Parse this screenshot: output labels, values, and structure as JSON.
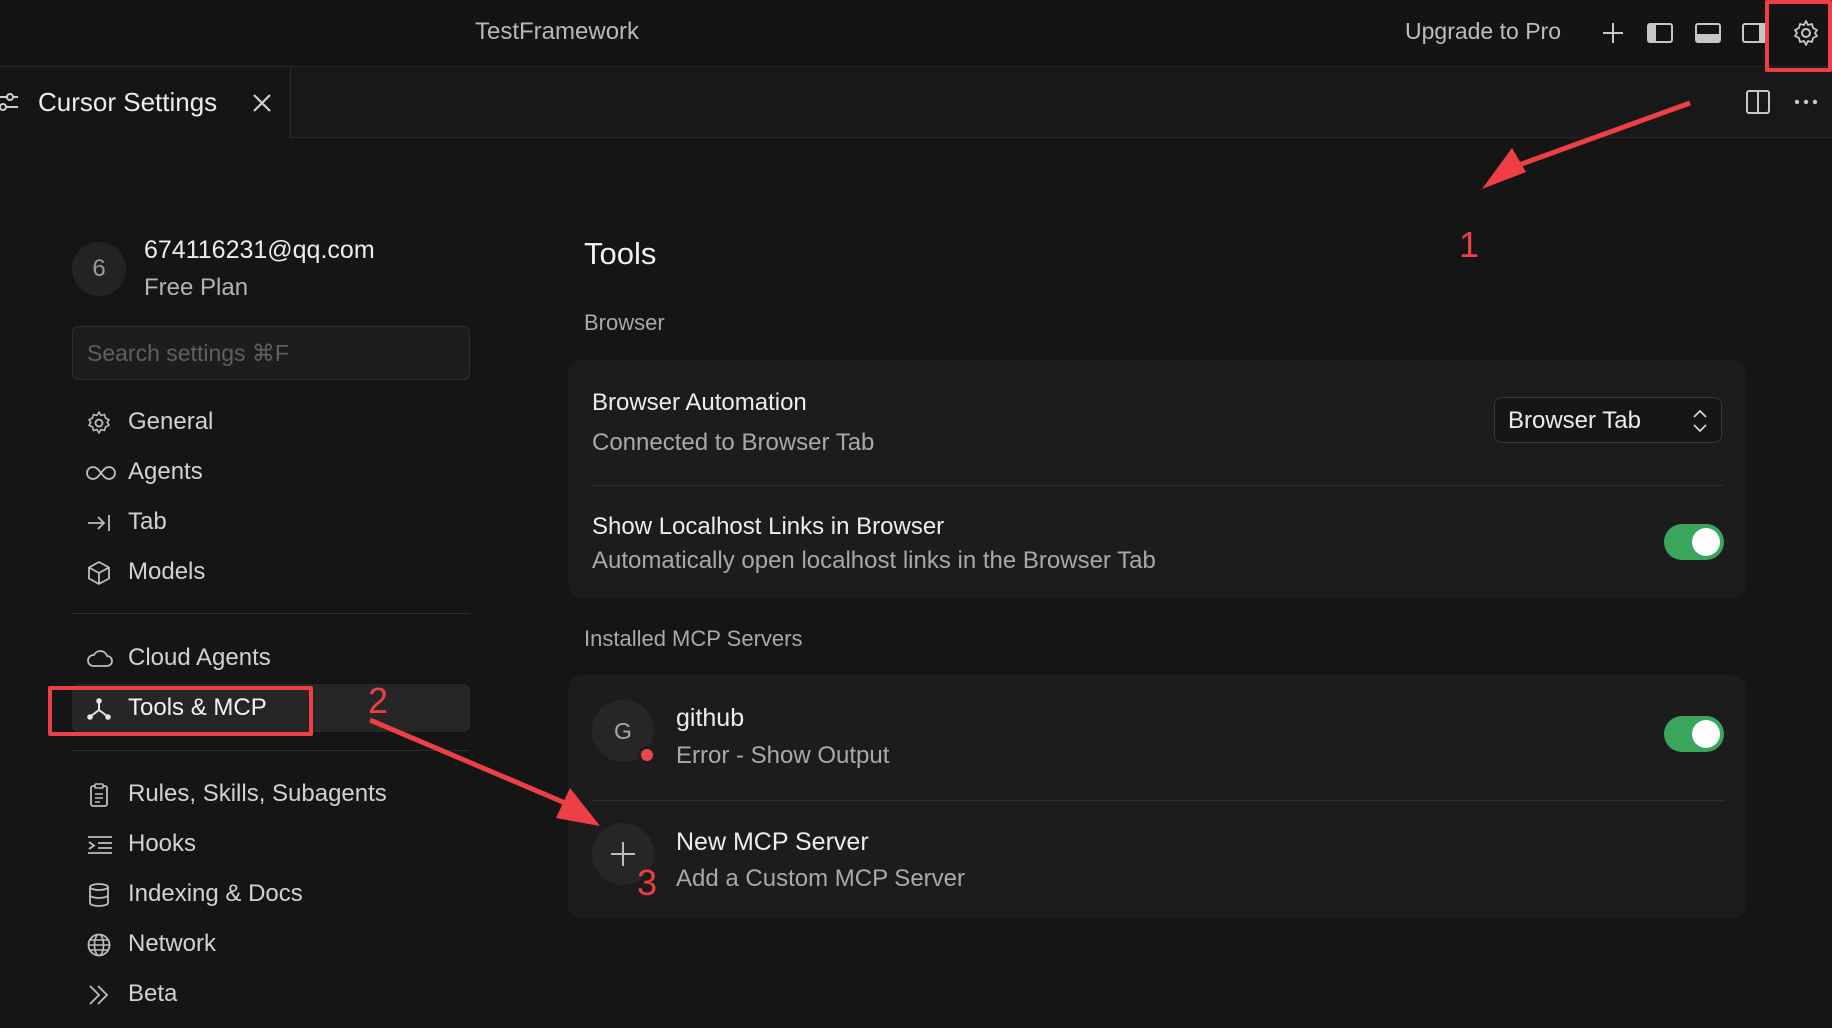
{
  "titlebar": {
    "app_title": "TestFramework",
    "upgrade_label": "Upgrade to Pro",
    "icons": [
      "plus-icon",
      "left-panel-icon",
      "bottom-panel-icon",
      "right-panel-icon",
      "gear-icon"
    ]
  },
  "tab": {
    "label": "Cursor Settings",
    "icons": [
      "sliders-icon",
      "close-icon",
      "split-editor-icon",
      "more-icon"
    ]
  },
  "account": {
    "avatar_initial": "6",
    "email": "674116231@qq.com",
    "plan": "Free Plan"
  },
  "search": {
    "placeholder": "Search settings ⌘F",
    "value": ""
  },
  "sidebar": {
    "items": [
      {
        "label": "General",
        "icon": "gear-icon"
      },
      {
        "label": "Agents",
        "icon": "infinity-icon"
      },
      {
        "label": "Tab",
        "icon": "tab-arrow-icon"
      },
      {
        "label": "Models",
        "icon": "cube-icon"
      },
      {
        "label": "Cloud Agents",
        "icon": "cloud-icon"
      },
      {
        "label": "Tools & MCP",
        "icon": "network-icon",
        "active": true
      },
      {
        "label": "Rules, Skills, Subagents",
        "icon": "clipboard-icon"
      },
      {
        "label": "Hooks",
        "icon": "hooks-icon"
      },
      {
        "label": "Indexing & Docs",
        "icon": "database-icon"
      },
      {
        "label": "Network",
        "icon": "globe-icon"
      },
      {
        "label": "Beta",
        "icon": "chevrons-right-icon"
      }
    ]
  },
  "main": {
    "title": "Tools",
    "browser_section": "Browser",
    "browser_automation": {
      "title": "Browser Automation",
      "subtitle": "Connected to Browser Tab",
      "selected": "Browser Tab"
    },
    "localhost_links": {
      "title": "Show Localhost Links in Browser",
      "subtitle": "Automatically open localhost links in the Browser Tab",
      "enabled": true
    },
    "mcp_section": "Installed MCP Servers",
    "servers": [
      {
        "initial": "G",
        "name": "github",
        "status": "Error - Show Output",
        "status_color": "#e5484d",
        "enabled": true
      }
    ],
    "new_server": {
      "title": "New MCP Server",
      "subtitle": "Add a Custom MCP Server"
    }
  },
  "annotations": {
    "color": "#ef3f46",
    "step1": "1",
    "step2": "2",
    "step3": "3"
  }
}
